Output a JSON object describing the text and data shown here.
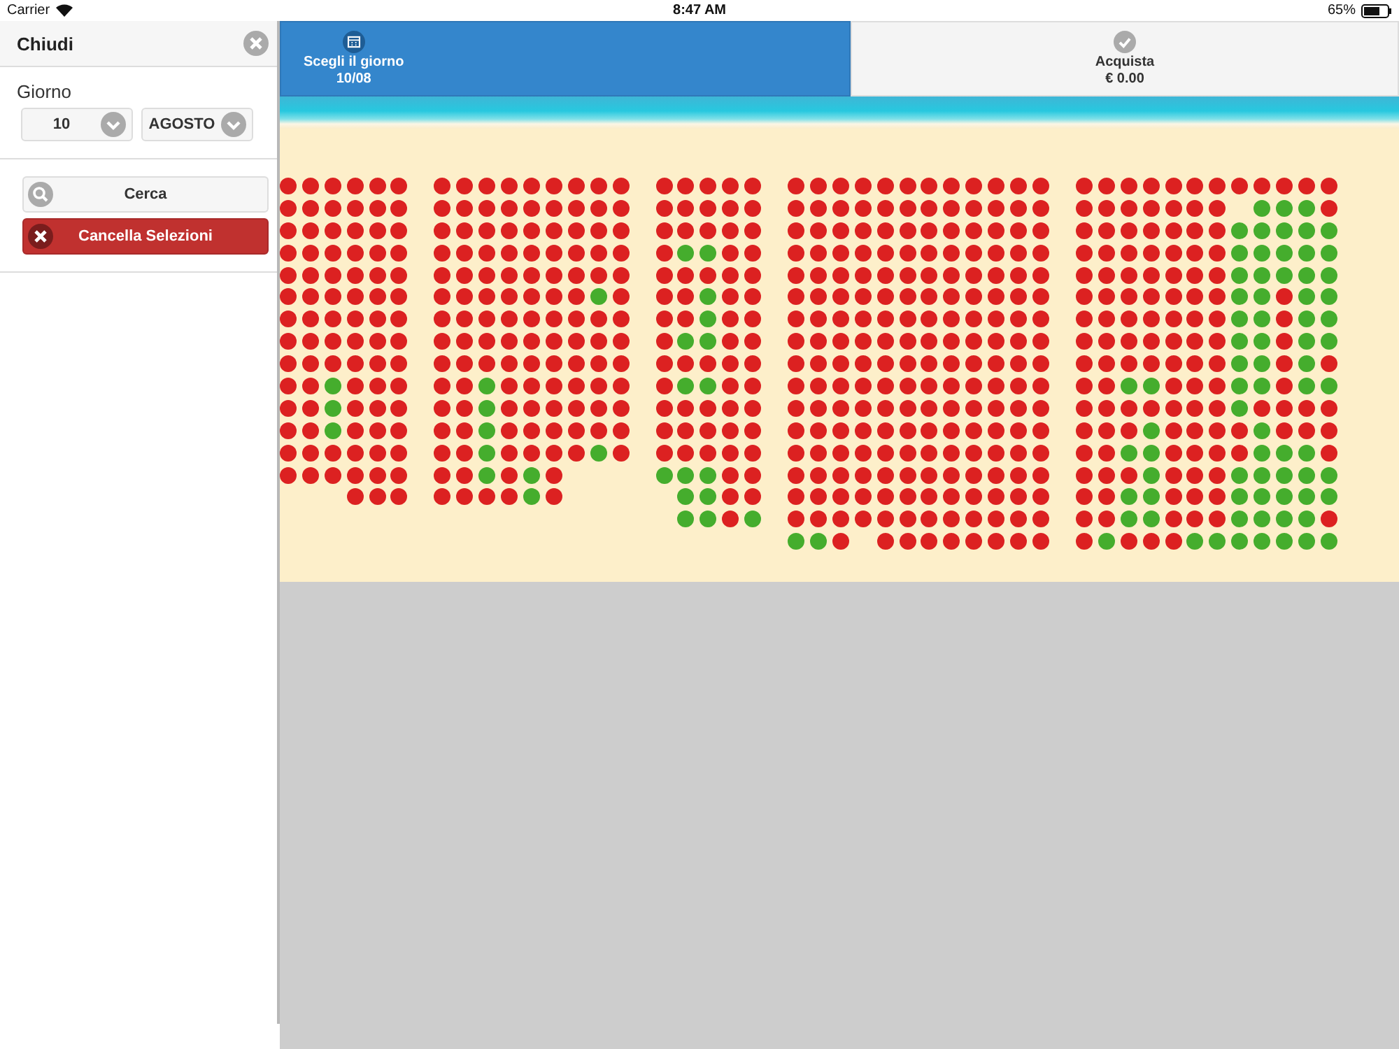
{
  "status_bar": {
    "carrier": "Carrier",
    "time": "8:47 AM",
    "battery": "65%"
  },
  "sidebar": {
    "close_label": "Chiudi",
    "day_label": "Giorno",
    "day_select": {
      "value": "10"
    },
    "month_select": {
      "value": "AGOSTO"
    },
    "buttons": [
      {
        "label": "Cerca",
        "kind": "search"
      },
      {
        "label": "Cancella Selezioni",
        "kind": "clear"
      }
    ]
  },
  "tabs": [
    {
      "label": "Scegli il giorno",
      "sublabel": "10/08",
      "selected": true,
      "kind": "calendar"
    },
    {
      "label": "Acquista",
      "sublabel": "€ 0.00",
      "selected": false,
      "kind": "check"
    }
  ],
  "beach": {
    "sections": [
      {
        "rows": [
          [
            true,
            true,
            true,
            true,
            true,
            true
          ],
          [
            true,
            true,
            true,
            true,
            true,
            true
          ],
          [
            true,
            true,
            true,
            true,
            true,
            true
          ],
          [
            true,
            true,
            true,
            true,
            true,
            true
          ],
          [
            true,
            true,
            true,
            true,
            true,
            true
          ],
          [
            true,
            true,
            true,
            true,
            true,
            true
          ],
          [
            true,
            true,
            true,
            true,
            true,
            true
          ],
          [
            true,
            true,
            true,
            true,
            true,
            true
          ],
          [
            true,
            true,
            true,
            true,
            true,
            true
          ],
          [
            true,
            true,
            false,
            true,
            true,
            true
          ],
          [
            true,
            true,
            false,
            true,
            true,
            true
          ],
          [
            true,
            true,
            false,
            true,
            true,
            true
          ],
          [
            true,
            true,
            true,
            true,
            true,
            true
          ],
          [
            true,
            true,
            true,
            true,
            true,
            true
          ],
          [
            null,
            null,
            null,
            true,
            true,
            true
          ]
        ]
      },
      {
        "rows": [
          [
            true,
            true,
            true,
            true,
            true,
            true,
            true,
            true,
            true
          ],
          [
            true,
            true,
            true,
            true,
            true,
            true,
            true,
            true,
            true
          ],
          [
            true,
            true,
            true,
            true,
            true,
            true,
            true,
            true,
            true
          ],
          [
            true,
            true,
            true,
            true,
            true,
            true,
            true,
            true,
            true
          ],
          [
            true,
            true,
            true,
            true,
            true,
            true,
            true,
            true,
            true
          ],
          [
            true,
            true,
            true,
            true,
            true,
            true,
            true,
            false,
            true
          ],
          [
            true,
            true,
            true,
            true,
            true,
            true,
            true,
            true,
            true
          ],
          [
            true,
            true,
            true,
            true,
            true,
            true,
            true,
            true,
            true
          ],
          [
            true,
            true,
            true,
            true,
            true,
            true,
            true,
            true,
            true
          ],
          [
            true,
            true,
            false,
            true,
            true,
            true,
            true,
            true,
            true
          ],
          [
            true,
            true,
            false,
            true,
            true,
            true,
            true,
            true,
            true
          ],
          [
            true,
            true,
            false,
            true,
            true,
            true,
            true,
            true,
            true
          ],
          [
            true,
            true,
            false,
            true,
            true,
            true,
            true,
            false,
            true
          ],
          [
            true,
            true,
            false,
            true,
            false,
            true
          ],
          [
            true,
            true,
            true,
            true,
            false,
            true
          ]
        ]
      },
      {
        "rows": [
          [
            true,
            true,
            true,
            true,
            true
          ],
          [
            true,
            true,
            true,
            true,
            true
          ],
          [
            true,
            true,
            true,
            true,
            true
          ],
          [
            true,
            false,
            false,
            true,
            true
          ],
          [
            true,
            true,
            true,
            true,
            true
          ],
          [
            true,
            true,
            false,
            true,
            true
          ],
          [
            true,
            true,
            false,
            true,
            true
          ],
          [
            true,
            false,
            false,
            true,
            true
          ],
          [
            true,
            true,
            true,
            true,
            true
          ],
          [
            true,
            false,
            false,
            true,
            true
          ],
          [
            true,
            true,
            true,
            true,
            true
          ],
          [
            true,
            true,
            true,
            true,
            true
          ],
          [
            true,
            true,
            true,
            true,
            true
          ],
          [
            false,
            false,
            false,
            true,
            true
          ],
          [
            null,
            false,
            false,
            true,
            true
          ],
          [
            null,
            false,
            false,
            true,
            false
          ]
        ]
      },
      {
        "rows": [
          [
            true,
            true,
            true,
            true,
            true,
            true,
            true,
            true,
            true,
            true,
            true,
            true
          ],
          [
            true,
            true,
            true,
            true,
            true,
            true,
            true,
            true,
            true,
            true,
            true,
            true
          ],
          [
            true,
            true,
            true,
            true,
            true,
            true,
            true,
            true,
            true,
            true,
            true,
            true
          ],
          [
            true,
            true,
            true,
            true,
            true,
            true,
            true,
            true,
            true,
            true,
            true,
            true
          ],
          [
            true,
            true,
            true,
            true,
            true,
            true,
            true,
            true,
            true,
            true,
            true,
            true
          ],
          [
            true,
            true,
            true,
            true,
            true,
            true,
            true,
            true,
            true,
            true,
            true,
            true
          ],
          [
            true,
            true,
            true,
            true,
            true,
            true,
            true,
            true,
            true,
            true,
            true,
            true
          ],
          [
            true,
            true,
            true,
            true,
            true,
            true,
            true,
            true,
            true,
            true,
            true,
            true
          ],
          [
            true,
            true,
            true,
            true,
            true,
            true,
            true,
            true,
            true,
            true,
            true,
            true
          ],
          [
            true,
            true,
            true,
            true,
            true,
            true,
            true,
            true,
            true,
            true,
            true,
            true
          ],
          [
            true,
            true,
            true,
            true,
            true,
            true,
            true,
            true,
            true,
            true,
            true,
            true
          ],
          [
            true,
            true,
            true,
            true,
            true,
            true,
            true,
            true,
            true,
            true,
            true,
            true
          ],
          [
            true,
            true,
            true,
            true,
            true,
            true,
            true,
            true,
            true,
            true,
            true,
            true
          ],
          [
            true,
            true,
            true,
            true,
            true,
            true,
            true,
            true,
            true,
            true,
            true,
            true
          ],
          [
            true,
            true,
            true,
            true,
            true,
            true,
            true,
            true,
            true,
            true,
            true,
            true
          ],
          [
            true,
            true,
            true,
            true,
            true,
            true,
            true,
            true,
            true,
            true,
            true,
            true
          ],
          [
            false,
            false,
            true,
            null,
            true,
            true,
            true,
            true,
            true,
            true,
            true,
            true
          ]
        ]
      },
      {
        "rows": [
          [
            true,
            true,
            true,
            true,
            true,
            true,
            true,
            true,
            true,
            true,
            true,
            true
          ],
          [
            true,
            true,
            true,
            true,
            true,
            true,
            true,
            null,
            false,
            false,
            false,
            true
          ],
          [
            true,
            true,
            true,
            true,
            true,
            true,
            true,
            false,
            false,
            false,
            false,
            false
          ],
          [
            true,
            true,
            true,
            true,
            true,
            true,
            true,
            false,
            false,
            false,
            false,
            false
          ],
          [
            true,
            true,
            true,
            true,
            true,
            true,
            true,
            false,
            false,
            false,
            false,
            false
          ],
          [
            true,
            true,
            true,
            true,
            true,
            true,
            true,
            false,
            false,
            true,
            false,
            false
          ],
          [
            true,
            true,
            true,
            true,
            true,
            true,
            true,
            false,
            false,
            true,
            false,
            false
          ],
          [
            true,
            true,
            true,
            true,
            true,
            true,
            true,
            false,
            false,
            true,
            false,
            false
          ],
          [
            true,
            true,
            true,
            true,
            true,
            true,
            true,
            false,
            false,
            true,
            false,
            true
          ],
          [
            true,
            true,
            false,
            false,
            true,
            true,
            true,
            false,
            false,
            true,
            false,
            false
          ],
          [
            true,
            true,
            true,
            true,
            true,
            true,
            true,
            false,
            true,
            true,
            true,
            true
          ],
          [
            true,
            true,
            true,
            false,
            true,
            true,
            true,
            true,
            false,
            true,
            true,
            true
          ],
          [
            true,
            true,
            false,
            false,
            true,
            true,
            true,
            true,
            false,
            false,
            false,
            true
          ],
          [
            true,
            true,
            true,
            false,
            true,
            true,
            true,
            false,
            false,
            false,
            false,
            false
          ],
          [
            true,
            true,
            false,
            false,
            true,
            true,
            true,
            false,
            false,
            false,
            false,
            false
          ],
          [
            true,
            true,
            false,
            false,
            true,
            true,
            true,
            false,
            false,
            false,
            false,
            true
          ],
          [
            true,
            false,
            true,
            true,
            true,
            false,
            false,
            false,
            false,
            false,
            false,
            false
          ]
        ]
      }
    ]
  }
}
